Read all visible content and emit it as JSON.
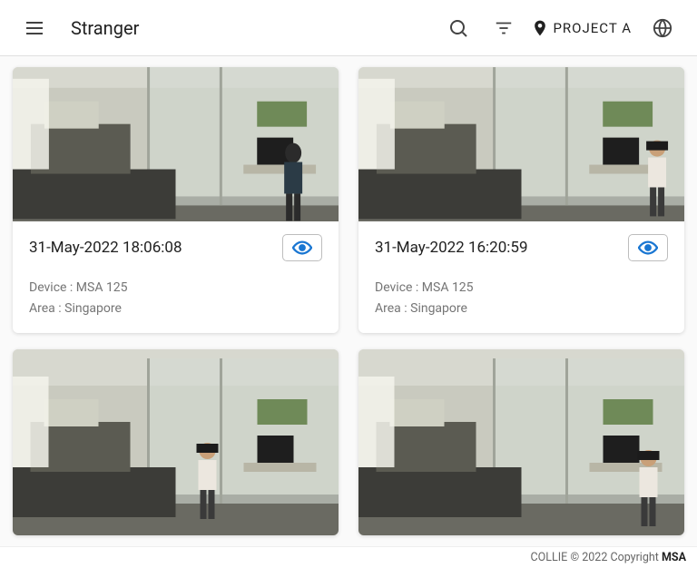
{
  "header": {
    "title": "Stranger",
    "project_label": "PROJECT A"
  },
  "labels": {
    "device_prefix": "Device : ",
    "area_prefix": "Area : "
  },
  "cards": [
    {
      "timestamp": "31-May-2022 18:06:08",
      "device": "MSA 125",
      "area": "Singapore"
    },
    {
      "timestamp": "31-May-2022 16:20:59",
      "device": "MSA 125",
      "area": "Singapore"
    },
    {
      "timestamp": "",
      "device": "",
      "area": ""
    },
    {
      "timestamp": "",
      "device": "",
      "area": ""
    }
  ],
  "footer": {
    "text": "COLLIE © 2022 Copyright ",
    "brand": "MSA"
  }
}
